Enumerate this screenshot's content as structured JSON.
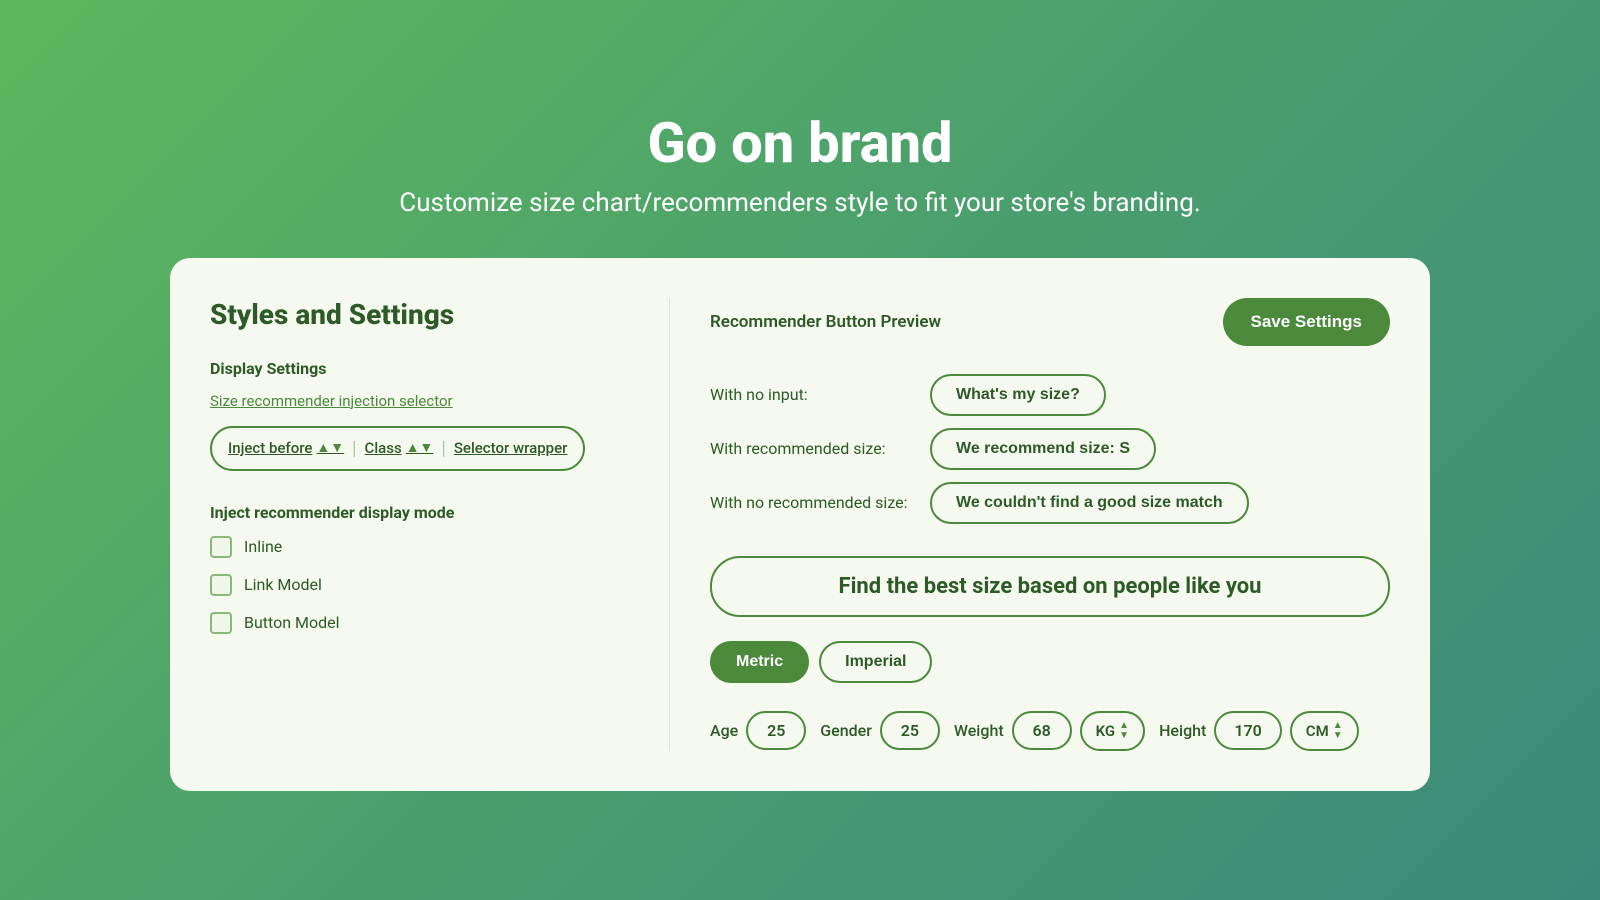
{
  "header": {
    "title": "Go on brand",
    "subtitle": "Customize size chart/recommenders style to fit your store's branding."
  },
  "left": {
    "panel_title": "Styles and Settings",
    "display_settings_label": "Display Settings",
    "injection_selector_link": "Size recommender injection selector",
    "selector": {
      "inject_before": "Inject before",
      "class": "Class",
      "selector_wrapper": "Selector wrapper"
    },
    "display_mode_label": "Inject recommender display mode",
    "checkboxes": [
      {
        "label": "Inline"
      },
      {
        "label": "Link Model"
      },
      {
        "label": "Button Model"
      }
    ]
  },
  "right": {
    "preview_label": "Recommender Button Preview",
    "save_button": "Save Settings",
    "preview_rows": [
      {
        "label": "With no input:",
        "button_text": "What's my size?"
      },
      {
        "label": "With recommended size:",
        "button_text": "We recommend size: S"
      },
      {
        "label": "With no recommended size:",
        "button_text": "We couldn't find a good size match"
      }
    ],
    "banner_text": "Find the best size based on people like you",
    "unit_toggle": {
      "metric": "Metric",
      "imperial": "Imperial"
    },
    "measurements": {
      "age_label": "Age",
      "age_value": "25",
      "gender_label": "Gender",
      "gender_value": "25",
      "weight_label": "Weight",
      "weight_value": "68",
      "weight_unit": "KG",
      "height_label": "Height",
      "height_value": "170",
      "height_unit": "CM"
    }
  }
}
